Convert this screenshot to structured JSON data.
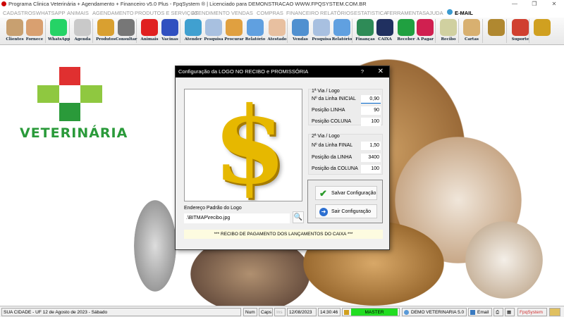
{
  "window": {
    "title": "Programa Clinica Veterinária + Agendamento + Financeiro v5.0 Plus - FpqSystem ® | Licenciado para  DEMONSTRACAO WWW.FPQSYSTEM.COM.BR",
    "minimize": "—",
    "maximize": "❐",
    "close": "✕"
  },
  "menu": [
    "CADASTROS",
    "WHATSAPP",
    "ANIMAIS",
    "AGENDAMENTO",
    "PRODUTOS E SERVIÇOS",
    "ATENDIMENTO",
    "VENDAS",
    "COMPRAS",
    "FINANCEIRO",
    "RELATÓRIOS",
    "ESTATISTICA",
    "FERRAMENTAS",
    "AJUDA",
    "E-MAIL"
  ],
  "toolbar": [
    {
      "label": "Clientes",
      "color": "#c8a070"
    },
    {
      "label": "Fornece",
      "color": "#d9a070"
    },
    {
      "label": "WhatsApp",
      "color": "#25d366"
    },
    {
      "label": "Agenda",
      "color": "#c9c9c9"
    },
    {
      "label": "Produtos",
      "color": "#d9a030"
    },
    {
      "label": "Consultar",
      "color": "#777"
    },
    {
      "label": "Animais",
      "color": "#e02020"
    },
    {
      "label": "Vacinas",
      "color": "#3050c0"
    },
    {
      "label": "Atender",
      "color": "#40a0d0"
    },
    {
      "label": "Pesquisa",
      "color": "#a8c0e0"
    },
    {
      "label": "Procurar",
      "color": "#e0a040"
    },
    {
      "label": "Relatório",
      "color": "#60a0e0"
    },
    {
      "label": "Atestado",
      "color": "#e8c0a0"
    },
    {
      "label": "Vendas",
      "color": "#5090d0"
    },
    {
      "label": "Pesquisa",
      "color": "#a8c0e0"
    },
    {
      "label": "Relatório",
      "color": "#60a0e0"
    },
    {
      "label": "Finanças",
      "color": "#2e8b57"
    },
    {
      "label": "CAIXA",
      "color": "#203060"
    },
    {
      "label": "Receber",
      "color": "#20a040"
    },
    {
      "label": "A Pagar",
      "color": "#d02050"
    },
    {
      "label": "Recibo",
      "color": "#d0d0a0"
    },
    {
      "label": "Cartas",
      "color": "#d8b070"
    },
    {
      "label": "",
      "color": "#b08830"
    },
    {
      "label": "Suporte",
      "color": "#d04030"
    },
    {
      "label": "",
      "color": "#d0a020"
    }
  ],
  "brand": {
    "name": "VETERINÁRIA",
    "red": "#e03030",
    "green": "#2a9a3a"
  },
  "dialog": {
    "title": "Configuração da LOGO NO RECIBO e PROMISSÓRIA",
    "help": "?",
    "close": "✕",
    "group1": {
      "title": "1ª Via / Logo",
      "rows": [
        {
          "label": "Nº da Linha INICIAL",
          "value": "0,90"
        },
        {
          "label": "Posição LINHA",
          "value": "90"
        },
        {
          "label": "Posição COLUNA",
          "value": "100"
        }
      ]
    },
    "group2": {
      "title": "2ª Via / Logo",
      "rows": [
        {
          "label": "Nº da Linha FINAL",
          "value": "1,50"
        },
        {
          "label": "Posição da LINHA",
          "value": "3400"
        },
        {
          "label": "Posição da COLUNA",
          "value": "100"
        }
      ]
    },
    "save": "Salvar Configuração",
    "exit": "Sair Configuração",
    "addr_label": "Endereço Padrão do Logo",
    "addr_value": ".\\BITMAP\\recibo.jpg",
    "footer": "*** RECIBO DE PAGAMENTO DOS LANÇAMENTOS DO CAIXA ***",
    "preview_glyph": "$"
  },
  "status": {
    "location": "SUA CIDADE - UF 12 de Agosto de 2023 - Sábado",
    "num": "Num",
    "caps": "Caps",
    "ins": "Ins",
    "date": "12/08/2023",
    "time": "14:30:46",
    "user": "MASTER",
    "db": "DEMO VETERINARIA 5.0",
    "email": "Email",
    "brand": "FpqSystem"
  }
}
